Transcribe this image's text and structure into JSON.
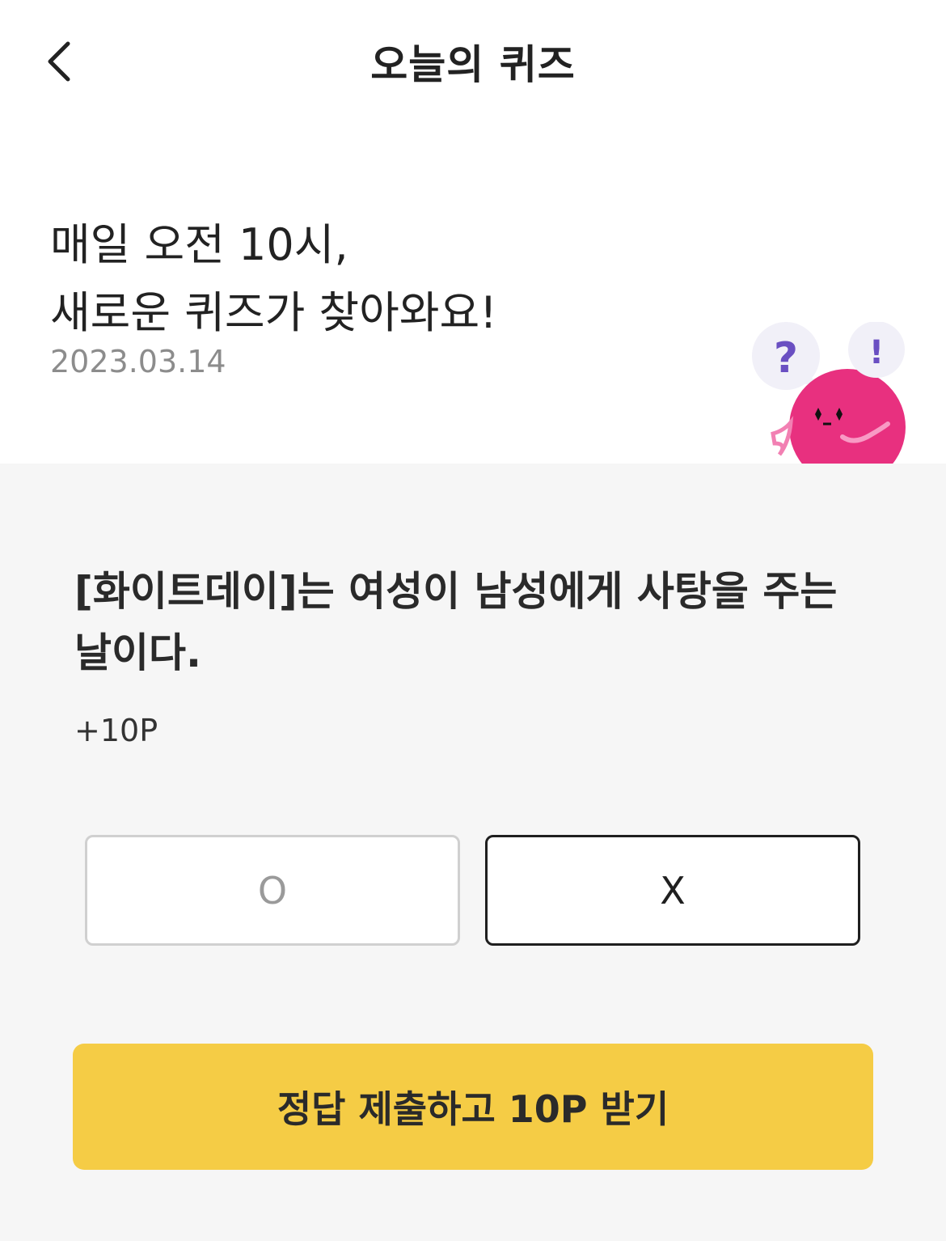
{
  "header": {
    "title": "오늘의 퀴즈",
    "back_icon": "chevron-left-icon"
  },
  "intro": {
    "line1": "매일 오전 10시,",
    "line2": "새로운 퀴즈가 찾아와요!",
    "date": "2023.03.14",
    "bubble_question": "?",
    "bubble_exclaim": "!"
  },
  "quiz": {
    "question": "[화이트데이]는 여성이 남성에게 사탕을 주는 날이다.",
    "points": "+10P",
    "options": {
      "o": "O",
      "x": "X"
    },
    "submit_label": "정답 제출하고 10P 받기"
  },
  "colors": {
    "accent": "#f5cc45",
    "mascot": "#e8307f",
    "bubble": "#f1f0f8",
    "question_mark": "#6a4fc2",
    "section_bg": "#f6f6f6"
  }
}
